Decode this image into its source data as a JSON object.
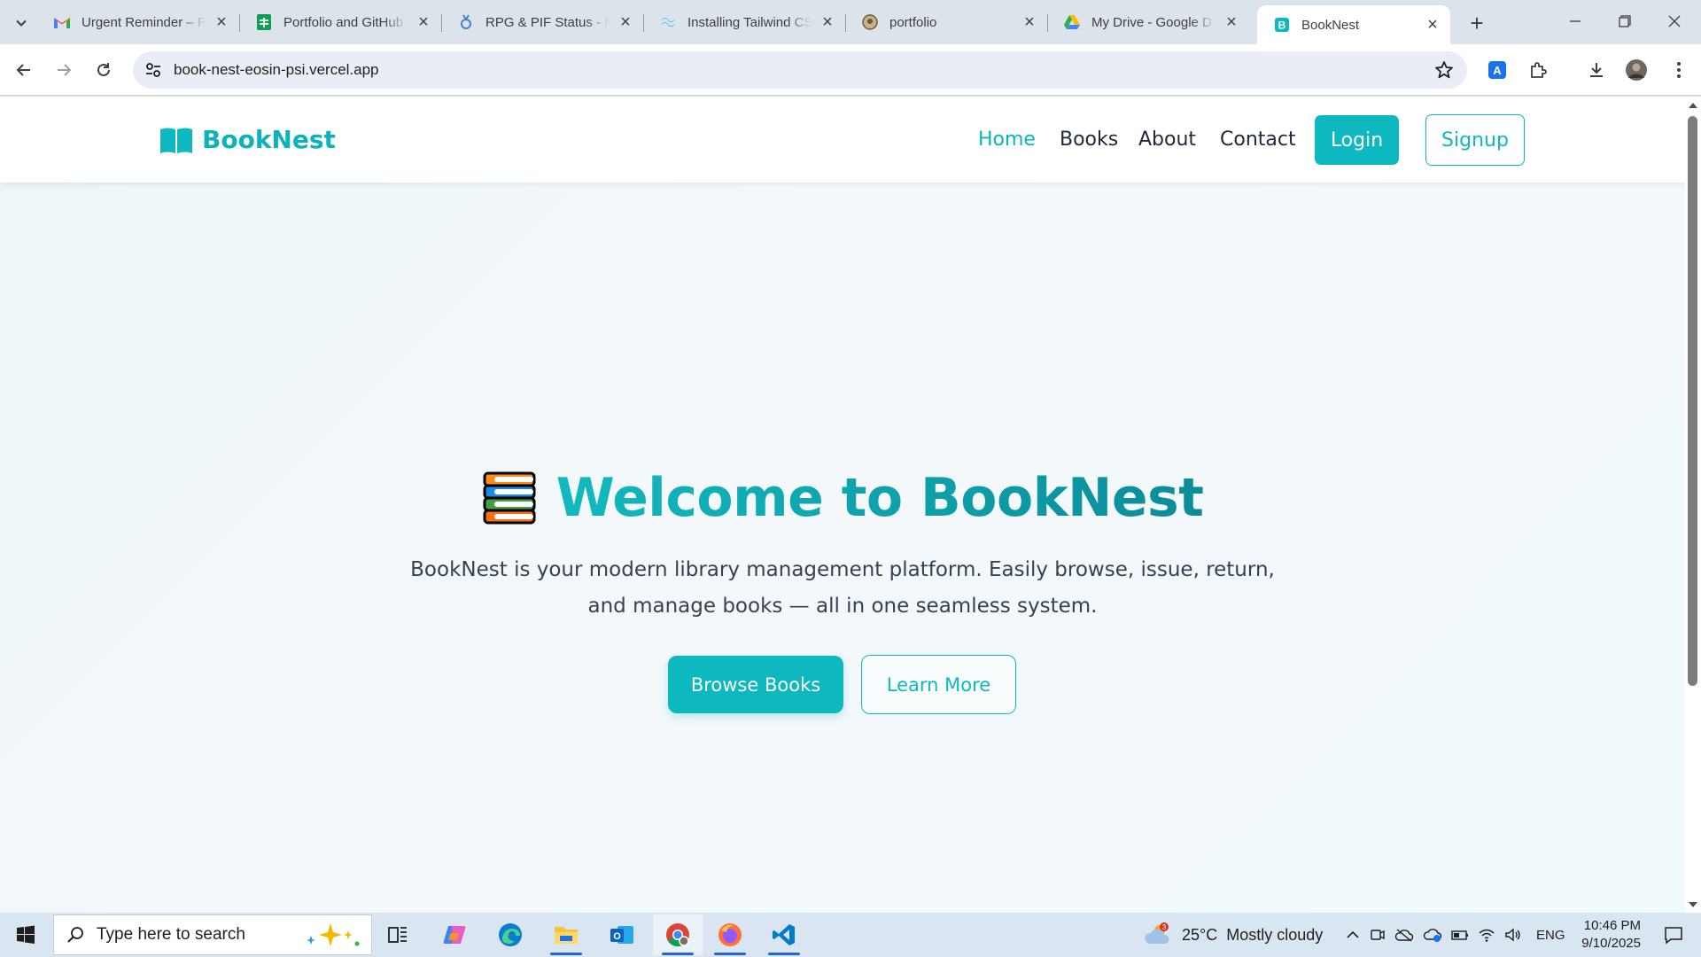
{
  "browser": {
    "tabs": [
      {
        "title": "Urgent Reminder – R",
        "icon": "gmail-icon",
        "active": false
      },
      {
        "title": "Portfolio and GitHub",
        "icon": "sheets-icon",
        "active": false
      },
      {
        "title": "RPG & PIF Status - M",
        "icon": "rpg-icon",
        "active": false
      },
      {
        "title": "Installing Tailwind CS",
        "icon": "tailwind-icon",
        "active": false
      },
      {
        "title": "portfolio",
        "icon": "portfolio-icon",
        "active": false
      },
      {
        "title": "My Drive - Google D",
        "icon": "drive-icon",
        "active": false
      },
      {
        "title": "BookNest",
        "icon": "booknest-favicon",
        "active": true
      }
    ],
    "url": "book-nest-eosin-psi.vercel.app"
  },
  "site": {
    "brand": "BookNest",
    "nav": [
      "Home",
      "Books",
      "About",
      "Contact"
    ],
    "login": "Login",
    "signup": "Signup"
  },
  "hero": {
    "title": "Welcome to BookNest",
    "description": "BookNest is your modern library management platform. Easily browse, issue, return, and manage books — all in one seamless system.",
    "primary_cta": "Browse Books",
    "secondary_cta": "Learn More"
  },
  "taskbar": {
    "search_placeholder": "Type here to search",
    "weather_temp": "25°C",
    "weather_desc": "Mostly cloudy",
    "weather_badge": "3",
    "language": "ENG",
    "time": "10:46 PM",
    "date": "9/10/2025"
  },
  "colors": {
    "brand": "#0db9bf",
    "text": "#1f2937",
    "accent_blue": "#2266cc"
  }
}
